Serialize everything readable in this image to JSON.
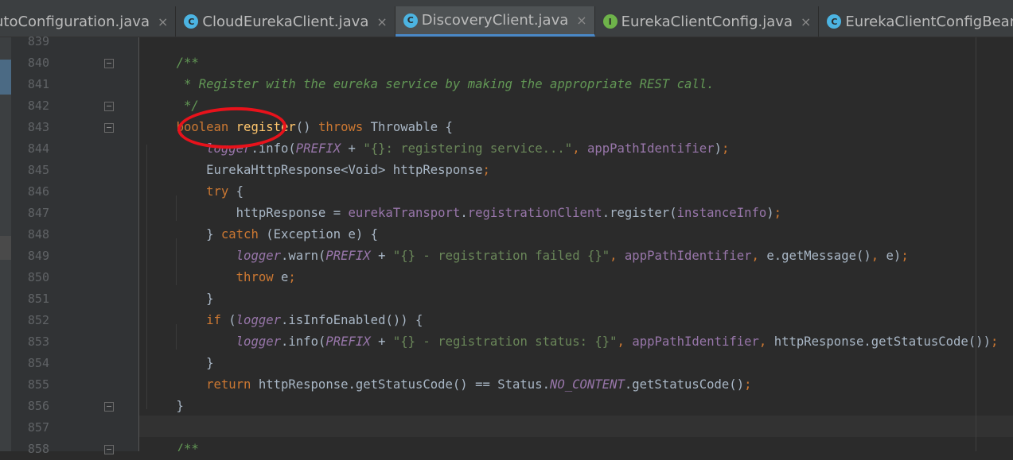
{
  "tabs": [
    {
      "label": "utoConfiguration.java",
      "icon": "",
      "active": false
    },
    {
      "label": "CloudEurekaClient.java",
      "icon": "C",
      "active": false
    },
    {
      "label": "DiscoveryClient.java",
      "icon": "C",
      "active": true
    },
    {
      "label": "EurekaClientConfig.java",
      "icon": "I",
      "active": false
    },
    {
      "label": "EurekaClientConfigBean.ja",
      "icon": "C",
      "active": false
    }
  ],
  "tab_close_glyph": "×",
  "colors": {
    "background": "#2b2b2b",
    "keyword": "#cc7832",
    "comment": "#629755",
    "field": "#9876aa",
    "string": "#6a8759",
    "method_decl": "#ffc66d",
    "annotation_circle": "#e8121b"
  },
  "lines": [
    {
      "number": "839",
      "fold": false,
      "tokens": []
    },
    {
      "number": "840",
      "fold": true,
      "tokens": [
        {
          "t": "    ",
          "c": "pl"
        },
        {
          "t": "/**",
          "c": "cm"
        }
      ]
    },
    {
      "number": "841",
      "fold": false,
      "tokens": [
        {
          "t": "     ",
          "c": "pl"
        },
        {
          "t": "* Register with the eureka service by making the appropriate REST call.",
          "c": "cm"
        }
      ]
    },
    {
      "number": "842",
      "fold": true,
      "tokens": [
        {
          "t": "     ",
          "c": "pl"
        },
        {
          "t": "*/",
          "c": "cm"
        }
      ]
    },
    {
      "number": "843",
      "fold": true,
      "tokens": [
        {
          "t": "    ",
          "c": "pl"
        },
        {
          "t": "boolean ",
          "c": "kw"
        },
        {
          "t": "register",
          "c": "mth"
        },
        {
          "t": "() ",
          "c": "pl"
        },
        {
          "t": "throws ",
          "c": "kw"
        },
        {
          "t": "Throwable {",
          "c": "pl"
        }
      ]
    },
    {
      "number": "844",
      "fold": false,
      "tokens": [
        {
          "t": "        ",
          "c": "pl"
        },
        {
          "t": "logger",
          "c": "st"
        },
        {
          "t": ".info(",
          "c": "pl"
        },
        {
          "t": "PREFIX",
          "c": "st"
        },
        {
          "t": " + ",
          "c": "pl"
        },
        {
          "t": "\"{}: registering service...\"",
          "c": "str"
        },
        {
          "t": ", ",
          "c": "kw"
        },
        {
          "t": "appPathIdentifier",
          "c": "fld"
        },
        {
          "t": ")",
          "c": "pl"
        },
        {
          "t": ";",
          "c": "kw"
        }
      ]
    },
    {
      "number": "845",
      "fold": false,
      "tokens": [
        {
          "t": "        EurekaHttpResponse<Void> httpResponse",
          "c": "pl"
        },
        {
          "t": ";",
          "c": "kw"
        }
      ]
    },
    {
      "number": "846",
      "fold": false,
      "tokens": [
        {
          "t": "        ",
          "c": "pl"
        },
        {
          "t": "try ",
          "c": "kw"
        },
        {
          "t": "{",
          "c": "pl"
        }
      ]
    },
    {
      "number": "847",
      "fold": false,
      "tokens": [
        {
          "t": "            httpResponse = ",
          "c": "pl"
        },
        {
          "t": "eurekaTransport",
          "c": "fld"
        },
        {
          "t": ".",
          "c": "pl"
        },
        {
          "t": "registrationClient",
          "c": "fld"
        },
        {
          "t": ".register(",
          "c": "pl"
        },
        {
          "t": "instanceInfo",
          "c": "fld"
        },
        {
          "t": ")",
          "c": "pl"
        },
        {
          "t": ";",
          "c": "kw"
        }
      ]
    },
    {
      "number": "848",
      "fold": false,
      "tokens": [
        {
          "t": "        } ",
          "c": "pl"
        },
        {
          "t": "catch ",
          "c": "kw"
        },
        {
          "t": "(Exception e) {",
          "c": "pl"
        }
      ]
    },
    {
      "number": "849",
      "fold": false,
      "tokens": [
        {
          "t": "            ",
          "c": "pl"
        },
        {
          "t": "logger",
          "c": "st"
        },
        {
          "t": ".warn(",
          "c": "pl"
        },
        {
          "t": "PREFIX",
          "c": "st"
        },
        {
          "t": " + ",
          "c": "pl"
        },
        {
          "t": "\"{} - registration failed {}\"",
          "c": "str"
        },
        {
          "t": ", ",
          "c": "kw"
        },
        {
          "t": "appPathIdentifier",
          "c": "fld"
        },
        {
          "t": ", ",
          "c": "kw"
        },
        {
          "t": "e.getMessage()",
          "c": "pl"
        },
        {
          "t": ", ",
          "c": "kw"
        },
        {
          "t": "e)",
          "c": "pl"
        },
        {
          "t": ";",
          "c": "kw"
        }
      ]
    },
    {
      "number": "850",
      "fold": false,
      "tokens": [
        {
          "t": "            ",
          "c": "pl"
        },
        {
          "t": "throw ",
          "c": "kw"
        },
        {
          "t": "e",
          "c": "pl"
        },
        {
          "t": ";",
          "c": "kw"
        }
      ]
    },
    {
      "number": "851",
      "fold": false,
      "tokens": [
        {
          "t": "        }",
          "c": "pl"
        }
      ]
    },
    {
      "number": "852",
      "fold": false,
      "tokens": [
        {
          "t": "        ",
          "c": "pl"
        },
        {
          "t": "if ",
          "c": "kw"
        },
        {
          "t": "(",
          "c": "pl"
        },
        {
          "t": "logger",
          "c": "st"
        },
        {
          "t": ".isInfoEnabled()) {",
          "c": "pl"
        }
      ]
    },
    {
      "number": "853",
      "fold": false,
      "tokens": [
        {
          "t": "            ",
          "c": "pl"
        },
        {
          "t": "logger",
          "c": "st"
        },
        {
          "t": ".info(",
          "c": "pl"
        },
        {
          "t": "PREFIX",
          "c": "st"
        },
        {
          "t": " + ",
          "c": "pl"
        },
        {
          "t": "\"{} - registration status: {}\"",
          "c": "str"
        },
        {
          "t": ", ",
          "c": "kw"
        },
        {
          "t": "appPathIdentifier",
          "c": "fld"
        },
        {
          "t": ", ",
          "c": "kw"
        },
        {
          "t": "httpResponse.getStatusCode())",
          "c": "pl"
        },
        {
          "t": ";",
          "c": "kw"
        }
      ]
    },
    {
      "number": "854",
      "fold": false,
      "tokens": [
        {
          "t": "        }",
          "c": "pl"
        }
      ]
    },
    {
      "number": "855",
      "fold": false,
      "tokens": [
        {
          "t": "        ",
          "c": "pl"
        },
        {
          "t": "return ",
          "c": "kw"
        },
        {
          "t": "httpResponse.getStatusCode() == Status.",
          "c": "pl"
        },
        {
          "t": "NO_CONTENT",
          "c": "st"
        },
        {
          "t": ".getStatusCode()",
          "c": "pl"
        },
        {
          "t": ";",
          "c": "kw"
        }
      ]
    },
    {
      "number": "856",
      "fold": true,
      "tokens": [
        {
          "t": "    }",
          "c": "pl"
        }
      ]
    },
    {
      "number": "857",
      "fold": false,
      "tokens": []
    },
    {
      "number": "858",
      "fold": true,
      "tokens": [
        {
          "t": "    ",
          "c": "pl"
        },
        {
          "t": "/**",
          "c": "cm"
        }
      ]
    }
  ]
}
